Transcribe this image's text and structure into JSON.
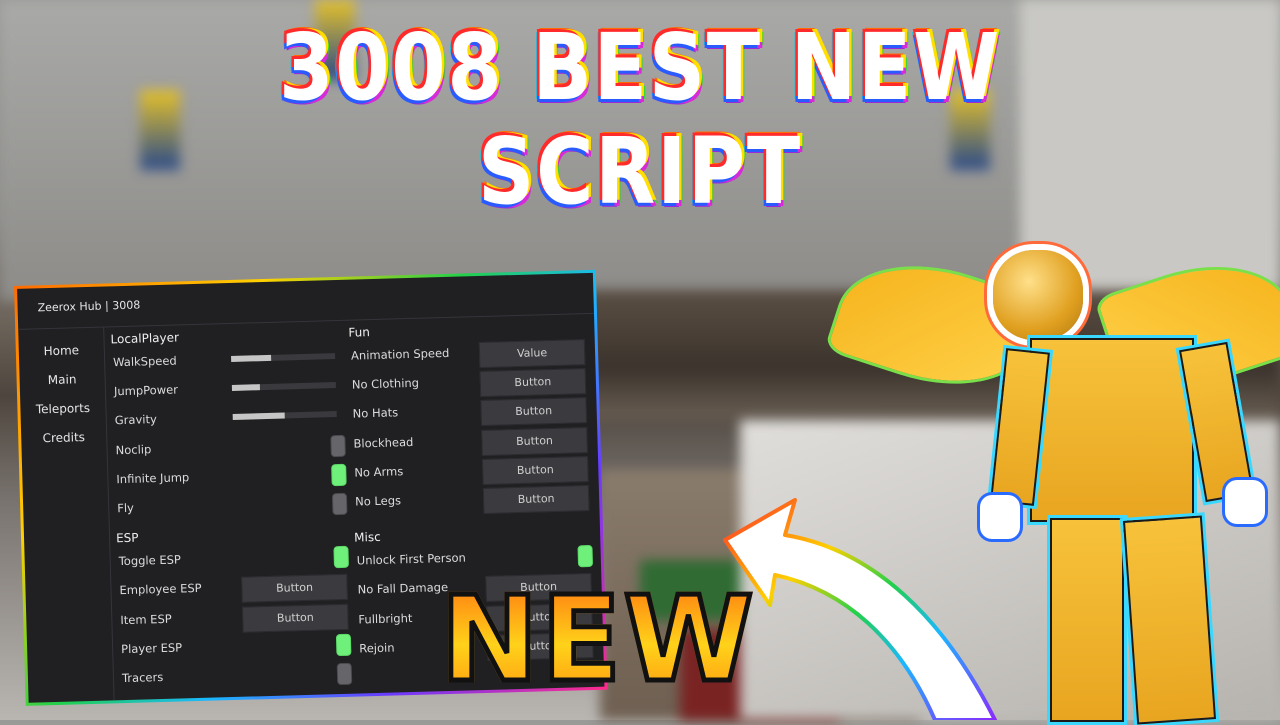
{
  "thumbnail": {
    "headline_line1": "3008 BEST NEW",
    "headline_line2": "SCRIPT",
    "badge_text": "NEW"
  },
  "window": {
    "title": "Zeerox Hub | 3008",
    "sidebar": {
      "items": [
        {
          "label": "Home"
        },
        {
          "label": "Main"
        },
        {
          "label": "Teleports"
        },
        {
          "label": "Credits"
        }
      ]
    },
    "left_column": {
      "localplayer": {
        "heading": "LocalPlayer",
        "rows": [
          {
            "label": "WalkSpeed",
            "control": "slider",
            "value_fraction": 0.38
          },
          {
            "label": "JumpPower",
            "control": "slider",
            "value_fraction": 0.27
          },
          {
            "label": "Gravity",
            "control": "slider",
            "value_fraction": 0.5
          },
          {
            "label": "Noclip",
            "control": "toggle",
            "on": false
          },
          {
            "label": "Infinite Jump",
            "control": "toggle",
            "on": true
          },
          {
            "label": "Fly",
            "control": "toggle",
            "on": false
          }
        ]
      },
      "esp": {
        "heading": "ESP",
        "rows": [
          {
            "label": "Toggle ESP",
            "control": "toggle",
            "on": true
          },
          {
            "label": "Employee ESP",
            "control": "button",
            "button_label": "Button"
          },
          {
            "label": "Item ESP",
            "control": "button",
            "button_label": "Button"
          },
          {
            "label": "Player ESP",
            "control": "toggle",
            "on": true
          },
          {
            "label": "Tracers",
            "control": "toggle",
            "on": false
          }
        ]
      }
    },
    "right_column": {
      "fun": {
        "heading": "Fun",
        "rows": [
          {
            "label": "Animation Speed",
            "control": "input",
            "placeholder": "Value"
          },
          {
            "label": "No Clothing",
            "control": "button",
            "button_label": "Button"
          },
          {
            "label": "No Hats",
            "control": "button",
            "button_label": "Button"
          },
          {
            "label": "Blockhead",
            "control": "button",
            "button_label": "Button"
          },
          {
            "label": "No Arms",
            "control": "button",
            "button_label": "Button"
          },
          {
            "label": "No Legs",
            "control": "button",
            "button_label": "Button"
          }
        ]
      },
      "misc": {
        "heading": "Misc",
        "rows": [
          {
            "label": "Unlock First Person",
            "control": "toggle",
            "on": true
          },
          {
            "label": "No Fall Damage",
            "control": "button",
            "button_label": "Button"
          },
          {
            "label": "Fullbright",
            "control": "button",
            "button_label": "Button"
          },
          {
            "label": "Rejoin",
            "control": "button",
            "button_label": "Button"
          }
        ]
      }
    }
  },
  "colors": {
    "toggle_on": "#6ef07a",
    "toggle_off": "#66666a",
    "window_bg": "#202023",
    "button_bg": "#3b3b3f"
  }
}
